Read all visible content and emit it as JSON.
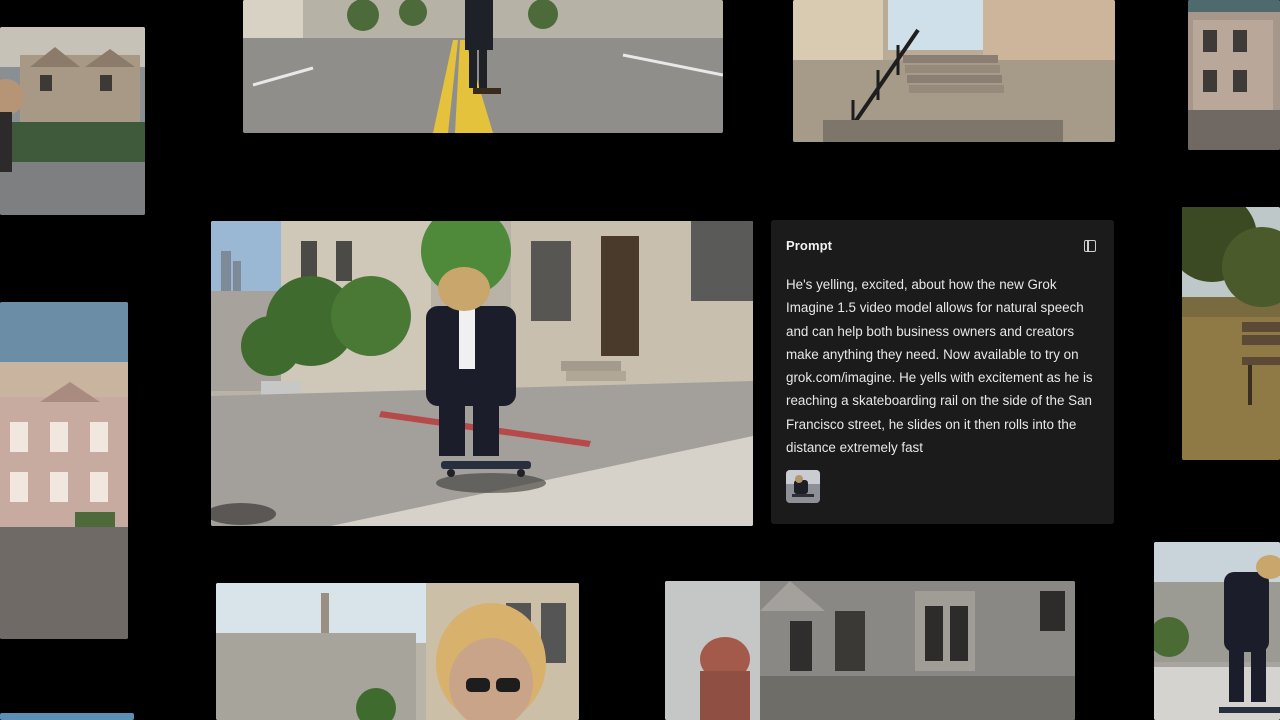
{
  "prompt_panel": {
    "title": "Prompt",
    "icon": "sidebar-panel-icon",
    "text": "He's yelling, excited, about how the new Grok Imagine 1.5 video model allows for natural speech and can help both business owners and creators make anything they need. Now available to try on grok.com/imagine. He yells with excitement as he is reaching a skateboarding rail on the side of the San Francisco street, he slides on it then rolls into the distance extremely fast",
    "thumbnail": "reference-image-thumbnail"
  },
  "tiles": [
    {
      "name": "tile-victorian-houses-top-left"
    },
    {
      "name": "tile-skater-street-top"
    },
    {
      "name": "tile-stairs-rail-top"
    },
    {
      "name": "tile-houses-top-right"
    },
    {
      "name": "tile-painted-ladies-left"
    },
    {
      "name": "tile-main-skater-video"
    },
    {
      "name": "tile-park-bench-right"
    },
    {
      "name": "tile-closeup-face-bottom"
    },
    {
      "name": "tile-victorian-building-bottom"
    },
    {
      "name": "tile-skater-hill-bottom-right"
    }
  ]
}
